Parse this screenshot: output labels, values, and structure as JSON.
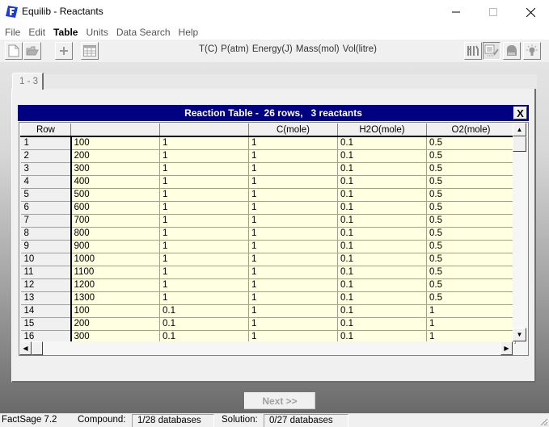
{
  "window": {
    "title": "Equilib - Reactants",
    "controls": {
      "minimize": "—",
      "maximize": "☐",
      "close": "✕"
    }
  },
  "menu": [
    {
      "label": "File",
      "bold": false
    },
    {
      "label": "Edit",
      "bold": false
    },
    {
      "label": "Table",
      "bold": true
    },
    {
      "label": "Units",
      "bold": false
    },
    {
      "label": "Data Search",
      "bold": false
    },
    {
      "label": "Help",
      "bold": false
    }
  ],
  "toolbar": {
    "left_buttons": [
      "new-file-icon",
      "open-folder-icon",
      "add-icon",
      "table-icon"
    ],
    "units": "T(C)  P(atm)  Energy(J)  Mass(mol)  Vol(litre)",
    "right_buttons": [
      "fork-knife-icon",
      "list-edit-icon",
      "head-icon",
      "lightbulb-icon"
    ]
  },
  "tab": {
    "label": "1 - 3"
  },
  "reaction_table": {
    "title": "Reaction Table -  26 rows,   3 reactants",
    "close_label": "X",
    "columns": [
      "Row",
      "",
      "",
      "C(mole)",
      "H2O(mole)",
      "O2(mole)"
    ],
    "rows": [
      [
        "1",
        "100",
        "1",
        "1",
        "0.1",
        "0.5"
      ],
      [
        "2",
        "200",
        "1",
        "1",
        "0.1",
        "0.5"
      ],
      [
        "3",
        "300",
        "1",
        "1",
        "0.1",
        "0.5"
      ],
      [
        "4",
        "400",
        "1",
        "1",
        "0.1",
        "0.5"
      ],
      [
        "5",
        "500",
        "1",
        "1",
        "0.1",
        "0.5"
      ],
      [
        "6",
        "600",
        "1",
        "1",
        "0.1",
        "0.5"
      ],
      [
        "7",
        "700",
        "1",
        "1",
        "0.1",
        "0.5"
      ],
      [
        "8",
        "800",
        "1",
        "1",
        "0.1",
        "0.5"
      ],
      [
        "9",
        "900",
        "1",
        "1",
        "0.1",
        "0.5"
      ],
      [
        "10",
        "1000",
        "1",
        "1",
        "0.1",
        "0.5"
      ],
      [
        "11",
        "1100",
        "1",
        "1",
        "0.1",
        "0.5"
      ],
      [
        "12",
        "1200",
        "1",
        "1",
        "0.1",
        "0.5"
      ],
      [
        "13",
        "1300",
        "1",
        "1",
        "0.1",
        "0.5"
      ],
      [
        "14",
        "100",
        "0.1",
        "1",
        "0.1",
        "1"
      ],
      [
        "15",
        "200",
        "0.1",
        "1",
        "0.1",
        "1"
      ],
      [
        "16",
        "300",
        "0.1",
        "1",
        "0.1",
        "1"
      ]
    ]
  },
  "next_button": {
    "label": "Next >>"
  },
  "statusbar": {
    "app": "FactSage 7.2",
    "compound_label": "Compound:",
    "compound_value": "1/28 databases",
    "solution_label": "Solution:",
    "solution_value": "0/27 databases"
  }
}
